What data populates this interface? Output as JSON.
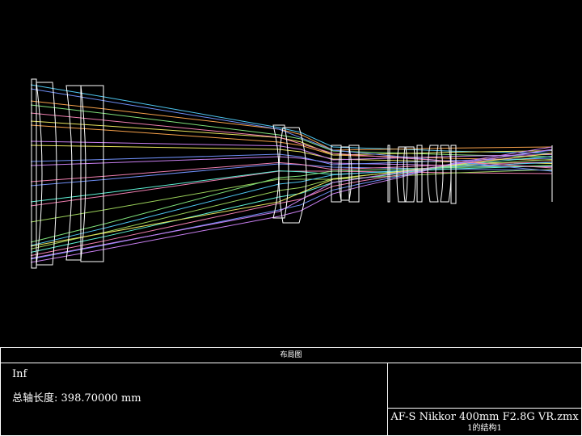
{
  "diagram": {
    "background": "#000000",
    "element_color": "#ffffff",
    "ray_colors": [
      "#4ec6f0",
      "#7fe07a",
      "#f5a04a",
      "#e7e35c",
      "#c87ff0",
      "#6e8ef5",
      "#f07fb0",
      "#5ef0d4",
      "#9bd15a"
    ],
    "ray_count_per_field": 7,
    "field_count": 3
  },
  "info_panel": {
    "title": "布局图",
    "object_distance": "Inf",
    "total_axial_length_label": "总轴长度:",
    "total_axial_length_value": "398.70000 mm",
    "file_name": "AF-S Nikkor 400mm F2.8G VR.zmx",
    "configuration": "1的结构1"
  }
}
